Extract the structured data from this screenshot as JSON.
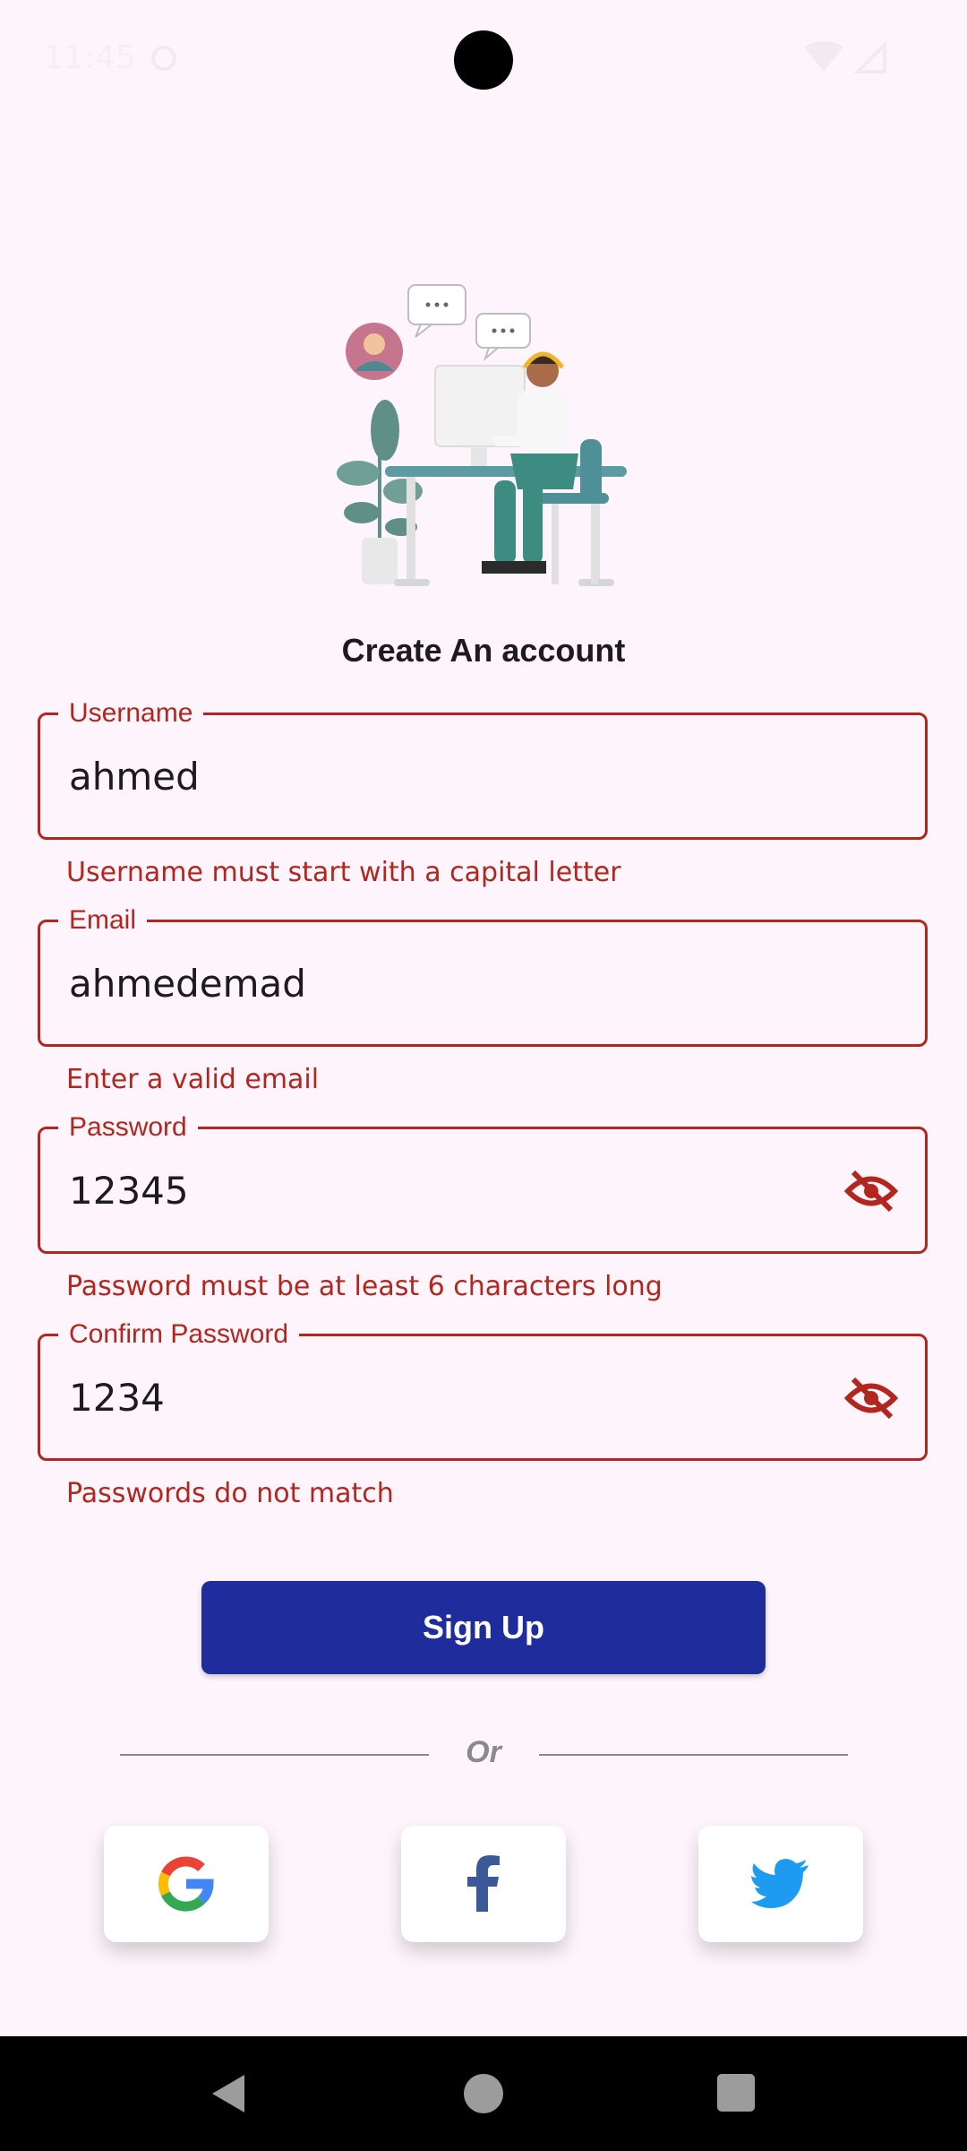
{
  "status_bar": {
    "time": "11:45"
  },
  "page": {
    "title": "Create An account"
  },
  "form": {
    "username": {
      "label": "Username",
      "value": "ahmed",
      "error": "Username must start with a capital letter"
    },
    "email": {
      "label": "Email",
      "value": "ahmedemad",
      "error": "Enter a valid email"
    },
    "password": {
      "label": "Password",
      "value": "12345",
      "error": "Password must be at least 6 characters long",
      "visibility_icon": "eye-off-icon"
    },
    "confirm_password": {
      "label": "Confirm Password",
      "value": "1234",
      "error": "Passwords do not match",
      "visibility_icon": "eye-off-icon"
    }
  },
  "actions": {
    "signup_label": "Sign Up",
    "separator_label": "Or"
  },
  "social": [
    {
      "name": "google",
      "icon": "google-icon"
    },
    {
      "name": "facebook",
      "icon": "facebook-icon"
    },
    {
      "name": "twitter",
      "icon": "twitter-icon"
    }
  ],
  "colors": {
    "background": "#fdf5fb",
    "error": "#b3261e",
    "primary_button": "#1f2d9c",
    "facebook": "#3b5998",
    "twitter": "#1d9bf0"
  }
}
